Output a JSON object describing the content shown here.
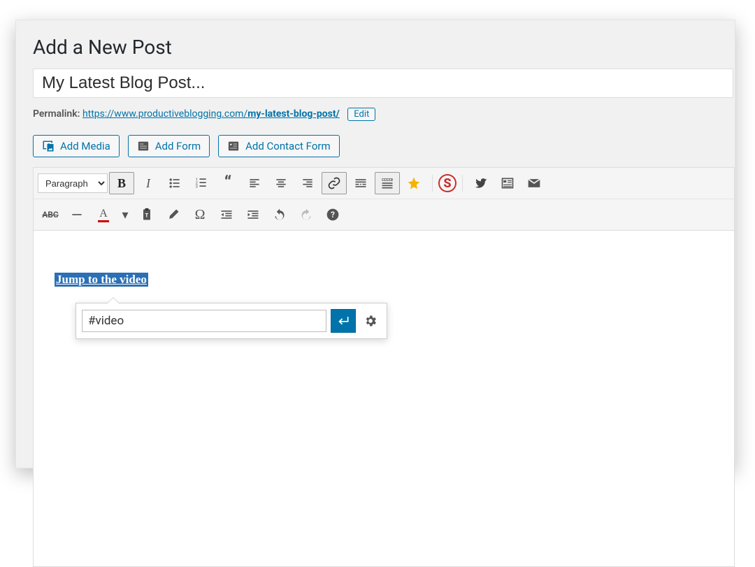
{
  "page": {
    "heading": "Add a New Post"
  },
  "title_field": {
    "value": "My Latest Blog Post..."
  },
  "permalink": {
    "label": "Permalink:",
    "base": "https://www.productiveblogging.com/",
    "slug": "my-latest-blog-post/",
    "edit_label": "Edit"
  },
  "media_buttons": {
    "add_media": "Add Media",
    "add_form": "Add Form",
    "add_contact_form": "Add Contact Form"
  },
  "toolbar": {
    "format_select": "Paragraph"
  },
  "content": {
    "selected_link_text": "Jump to the video",
    "link_popover": {
      "url_value": "#video"
    }
  }
}
